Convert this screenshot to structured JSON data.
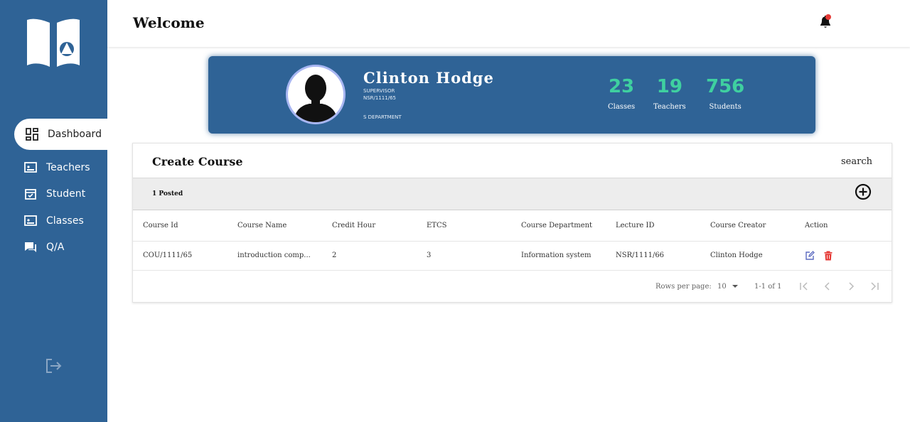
{
  "nav": {
    "items": [
      {
        "label": "Dashboard",
        "icon": "dashboard-icon"
      },
      {
        "label": "Teachers",
        "icon": "teachers-icon"
      },
      {
        "label": "Student",
        "icon": "calendar-icon"
      },
      {
        "label": "Classes",
        "icon": "classes-icon"
      },
      {
        "label": "Q/A",
        "icon": "chat-icon"
      }
    ],
    "active": "Dashboard"
  },
  "header": {
    "title": "Welcome",
    "notification_dot_color": "#e53935"
  },
  "profile": {
    "name": "Clinton Hodge",
    "role": "SUPERVISOR",
    "id": "NSR/1111/65",
    "department": "S DEPARTMENT",
    "stats": [
      {
        "value": "23",
        "label": "Classes"
      },
      {
        "value": "19",
        "label": "Teachers"
      },
      {
        "value": "756",
        "label": "Students"
      }
    ]
  },
  "courses": {
    "title": "Create Course",
    "search_label": "search",
    "posted": "1 Posted",
    "columns": [
      "Course Id",
      "Course Name",
      "Credit Hour",
      "ETCS",
      "Course Department",
      "Lecture ID",
      "Course Creator",
      "Action"
    ],
    "rows": [
      [
        "COU/1111/65",
        "introduction comp...",
        "2",
        "3",
        "Information system",
        "NSR/1111/66",
        "Clinton Hodge"
      ]
    ],
    "pagination": {
      "rows_per_page_label": "Rows per page:",
      "rows_per_page": "10",
      "range": "1-1 of 1"
    }
  },
  "colors": {
    "primary": "#2f6396",
    "stat_accent": "#3fd0a0",
    "edit": "#5c6bc0",
    "delete": "#e53935"
  }
}
